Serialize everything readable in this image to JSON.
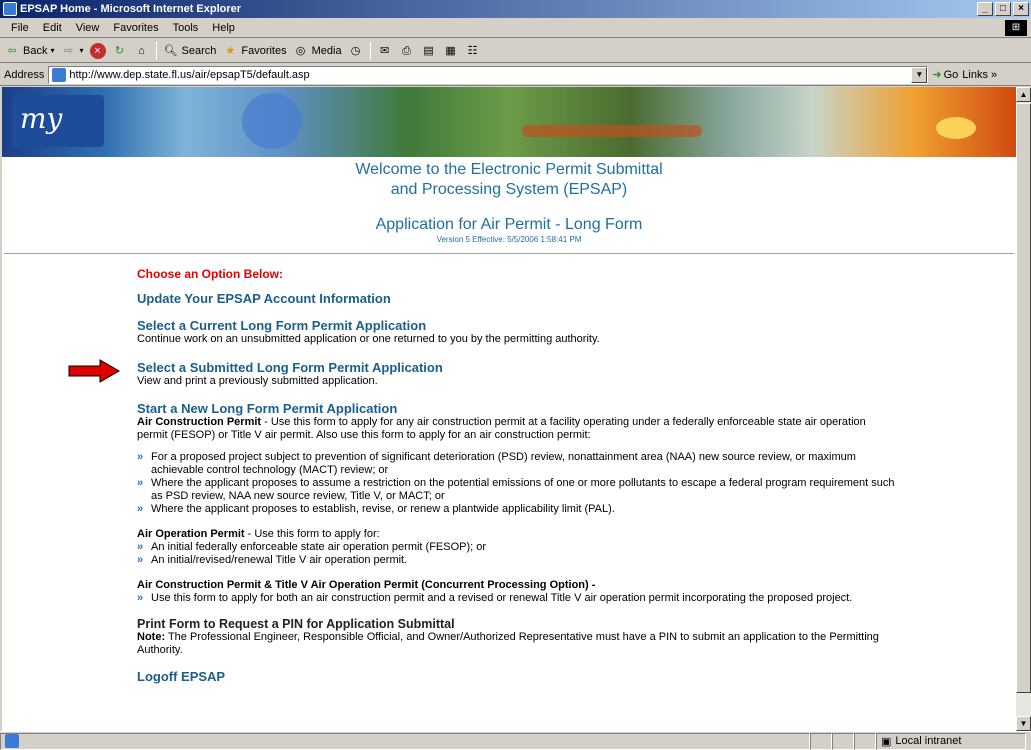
{
  "window": {
    "title": "EPSAP Home - Microsoft Internet Explorer",
    "controls": [
      "_",
      "□",
      "×"
    ]
  },
  "menu": [
    "File",
    "Edit",
    "View",
    "Favorites",
    "Tools",
    "Help"
  ],
  "toolbar": {
    "back": "Back",
    "search": "Search",
    "favorites": "Favorites",
    "media": "Media"
  },
  "address": {
    "label": "Address",
    "url": "http://www.dep.state.fl.us/air/epsapT5/default.asp",
    "go": "Go",
    "links": "Links"
  },
  "banner": {
    "logo_text": "my"
  },
  "header": {
    "welcome_line1": "Welcome to the Electronic Permit Submittal",
    "welcome_line2": "and Processing System (EPSAP)",
    "app_title": "Application for Air Permit - Long Form",
    "version": "Version 5 Effective: 5/5/2006 1:58:41 PM"
  },
  "content": {
    "choose": "Choose an Option Below:",
    "update": "Update Your EPSAP Account Information",
    "select_current": "Select a Current Long Form Permit Application",
    "select_current_desc": "Continue work on an unsubmitted application or one returned to you by the permitting authority.",
    "select_submitted": "Select a Submitted Long Form Permit Application",
    "select_submitted_desc": "View and print a previously submitted application.",
    "start_new": "Start a New Long Form Permit Application",
    "acp_label": "Air Construction Permit",
    "acp_desc": " - Use this form to apply for any air construction permit at a facility operating under a federally enforceable state air operation permit (FESOP) or Title V air permit. Also use this form to apply for an air construction permit:",
    "acp_bullets": [
      "For a proposed project subject to prevention of significant deterioration (PSD) review, nonattainment area (NAA) new source review, or maximum achievable control technology (MACT) review; or",
      "Where the applicant proposes to assume a restriction on the potential emissions of one or more pollutants to escape a federal program requirement such as PSD review, NAA new source review, Title V, or MACT; or",
      "Where the applicant proposes to establish, revise, or renew a plantwide applicability limit (PAL)."
    ],
    "aop_label": "Air Operation Permit",
    "aop_desc": " - Use this form to apply for:",
    "aop_bullets": [
      "An initial federally enforceable state air operation permit (FESOP); or",
      "An initial/revised/renewal Title V air operation permit."
    ],
    "concurrent_label": "Air Construction Permit & Title V Air Operation Permit (Concurrent Processing Option) -",
    "concurrent_bullets": [
      "Use this form to apply for both an air construction permit and a revised or renewal Title V air operation permit incorporating the proposed project."
    ],
    "print_pin": "Print Form to Request a PIN for Application Submittal",
    "note_label": "Note:",
    "note_text": " The Professional Engineer, Responsible Official, and Owner/Authorized Representative must have a PIN to submit an application to the Permitting Authority.",
    "logoff": "Logoff EPSAP"
  },
  "status": {
    "zone": "Local intranet"
  },
  "colors": {
    "link": "#1a5e8c",
    "heading": "#1f6fa0",
    "choose": "#e00000",
    "arrow": "#e00000"
  }
}
